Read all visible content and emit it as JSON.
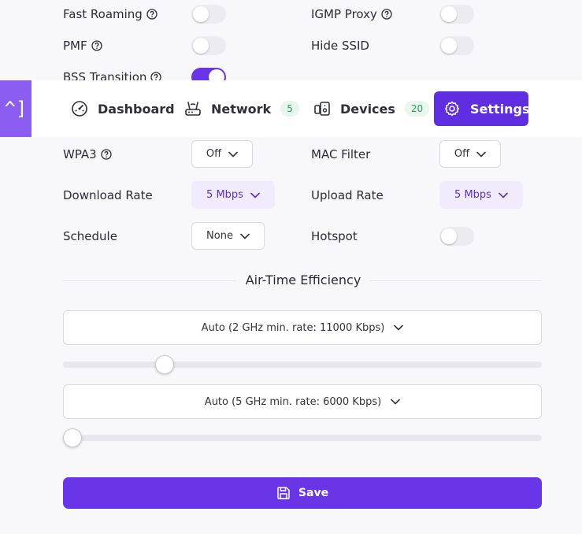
{
  "top_settings": {
    "fast_roaming": {
      "label": "Fast Roaming",
      "on": false
    },
    "igmp_proxy": {
      "label": "IGMP Proxy",
      "on": false
    },
    "pmf": {
      "label": "PMF",
      "on": false
    },
    "hide_ssid": {
      "label": "Hide SSID",
      "on": false
    },
    "bss_transition": {
      "label": "BSS Transition",
      "on": true
    }
  },
  "nav": {
    "logo_glyph": "^]",
    "dashboard": {
      "label": "Dashboard",
      "icon": "gauge-icon"
    },
    "network": {
      "label": "Network",
      "icon": "router-icon",
      "badge": "5"
    },
    "devices": {
      "label": "Devices",
      "icon": "devices-icon",
      "badge": "20"
    },
    "settings": {
      "label": "Settings",
      "icon": "gear-icon",
      "active": true
    }
  },
  "settings": {
    "wpa3": {
      "label": "WPA3",
      "value": "Off"
    },
    "mac_filter": {
      "label": "MAC Filter",
      "value": "Off"
    },
    "download_rate": {
      "label": "Download Rate",
      "value": "5 Mbps"
    },
    "upload_rate": {
      "label": "Upload Rate",
      "value": "5 Mbps"
    },
    "schedule": {
      "label": "Schedule",
      "value": "None"
    },
    "hotspot": {
      "label": "Hotspot",
      "on": false
    }
  },
  "airtime": {
    "title": "Air-Time Efficiency",
    "select_2ghz": "Auto (2 GHz min. rate: 11000 Kbps)",
    "slider_2ghz_fraction": 0.2,
    "select_5ghz": "Auto (5 GHz min. rate: 6000 Kbps)",
    "slider_5ghz_fraction": 0.0
  },
  "save_label": "Save",
  "colors": {
    "accent": "#6a35e6",
    "accent_dark": "#5f2ee0",
    "logo_bg": "#8b5df0",
    "badge_bg": "#e7f7ed",
    "badge_text": "#2d9a5b"
  }
}
